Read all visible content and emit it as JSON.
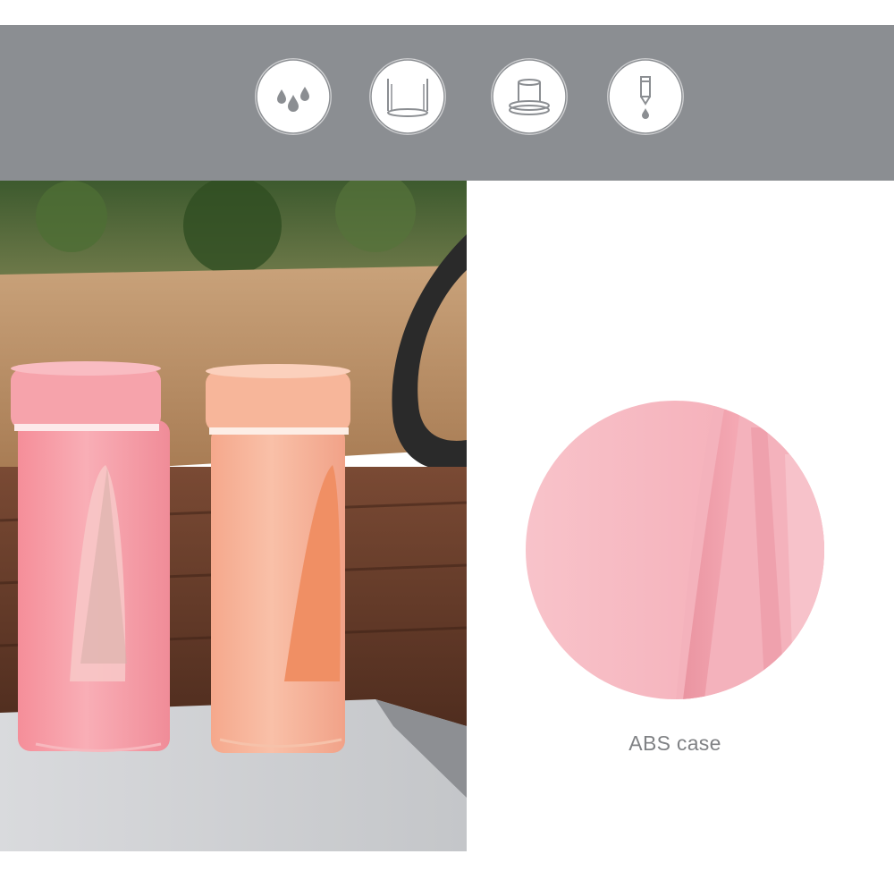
{
  "feature_icons": [
    {
      "icon": "water-drops-icon"
    },
    {
      "icon": "glass-cup-icon"
    },
    {
      "icon": "cup-lid-icon"
    },
    {
      "icon": "pencil-drop-icon"
    }
  ],
  "product_photo": {
    "description_icon": "pink-bottles-photo"
  },
  "material_detail": {
    "caption": "ABS case"
  },
  "colors": {
    "banner": "#8b8e92",
    "icon_stroke": "#8b8e92",
    "pink_bottle": "#f6a3ab",
    "peach_bottle": "#f7b69a",
    "zoom_pink": "#f6b9c2",
    "caption": "#808285"
  }
}
